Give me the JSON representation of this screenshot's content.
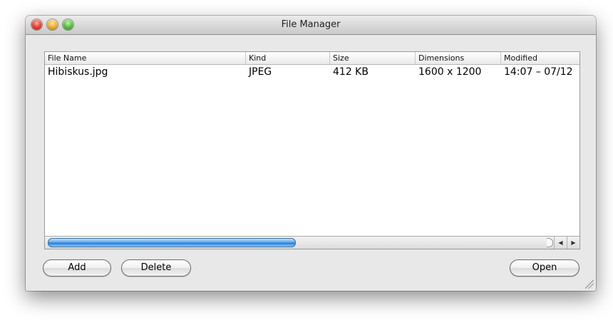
{
  "window": {
    "title": "File Manager"
  },
  "table": {
    "columns": [
      "File Name",
      "Kind",
      "Size",
      "Dimensions",
      "Modified"
    ],
    "rows": [
      [
        "Hibiskus.jpg",
        "JPEG",
        "412 KB",
        "1600 x 1200",
        "14:07 – 07/12"
      ]
    ]
  },
  "buttons": {
    "add": "Add",
    "delete": "Delete",
    "open": "Open"
  },
  "scroll_arrows": {
    "left": "◀",
    "right": "▶"
  }
}
